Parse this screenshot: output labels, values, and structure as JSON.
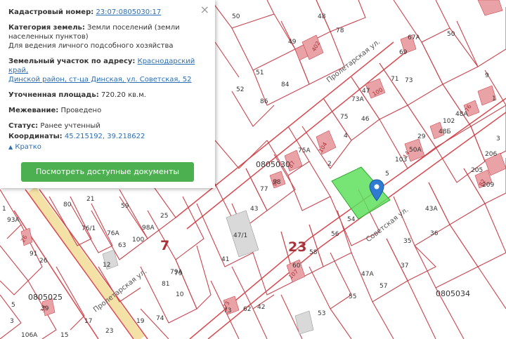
{
  "panel": {
    "close_label": "×",
    "cadastral_number": {
      "label": "Кадастровый номер:",
      "value": "23:07:0805030:17"
    },
    "land_category": {
      "label": "Категория земель:",
      "value": "Земли поселений (земли населенных пунктов)",
      "use": "Для ведения личного подсобного хозяйства"
    },
    "address": {
      "label": "Земельный участок по адресу:",
      "value_line1": "Краснодарский край,",
      "value_line2": "Динской район, ст-ца Динская, ул. Советская, 52"
    },
    "area": {
      "label": "Уточненная площадь:",
      "value": "720.20 кв.м."
    },
    "survey": {
      "label": "Межевание:",
      "value": "Проведено"
    },
    "status": {
      "label": "Статус:",
      "value": "Ранее учтенный"
    },
    "coords": {
      "label": "Координаты:",
      "value": "45.215192, 39.218622"
    },
    "collapse_label": "Кратко",
    "docs_button": "Посмотреть доступные документы"
  },
  "map": {
    "streets": {
      "proletarskaya_top": "Пролетарская ул.",
      "proletarskaya_bottom": "Пролетарская ул.",
      "sovetskaya": "Советская ул."
    },
    "blocks": {
      "b1": "0805030",
      "b2": "0805025",
      "b3": "0805034"
    },
    "districts": {
      "big": "23",
      "small": "7"
    },
    "parcel_numbers": [
      "48",
      "78",
      "49",
      "50",
      "51",
      "52",
      "84",
      "86",
      "50",
      "67A",
      "69",
      "71",
      "73",
      "73A",
      "47",
      "75",
      "4",
      "46",
      "75A",
      "2",
      "98",
      "77",
      "43",
      "47/1",
      "54",
      "56",
      "58",
      "60",
      "103",
      "29",
      "50A",
      "102",
      "48A",
      "48Б",
      "9",
      "1",
      "3",
      "5",
      "206",
      "205",
      "209",
      "43A",
      "36",
      "35",
      "37",
      "47A",
      "41",
      "42",
      "62",
      "73",
      "53",
      "55",
      "57",
      "0805034",
      "79",
      "80",
      "93A",
      "91",
      "26",
      "76/1",
      "76A",
      "98A",
      "100",
      "63",
      "59",
      "25",
      "21",
      "12",
      "79A",
      "81",
      "10",
      "74",
      "5",
      "39",
      "106A",
      "1",
      "3",
      "15",
      "17",
      "19",
      "23"
    ],
    "building_numbers": [
      "402",
      "100",
      "104",
      "98",
      "87",
      "107",
      "73",
      "76",
      "14",
      "26",
      "89",
      "82",
      "209",
      "39"
    ]
  }
}
